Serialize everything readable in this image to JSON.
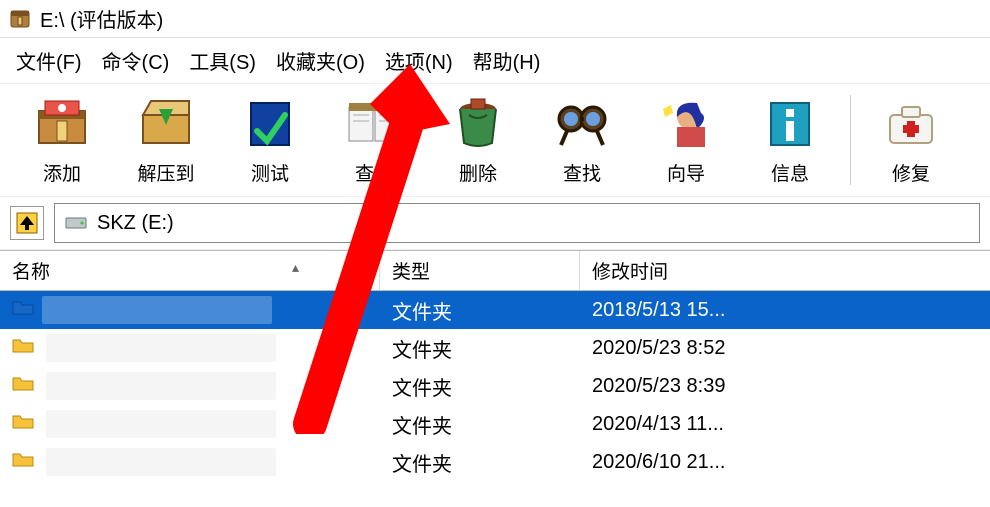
{
  "window": {
    "title": "E:\\ (评估版本)"
  },
  "menu": {
    "file": "文件(F)",
    "cmd": "命令(C)",
    "tools": "工具(S)",
    "fav": "收藏夹(O)",
    "opt": "选项(N)",
    "help": "帮助(H)"
  },
  "toolbar": {
    "add": "添加",
    "extract": "解压到",
    "test": "测试",
    "view": "查看",
    "delete": "删除",
    "find": "查找",
    "wizard": "向导",
    "info": "信息",
    "repair": "修复"
  },
  "path": {
    "label": "SKZ (E:)"
  },
  "columns": {
    "name": "名称",
    "type": "类型",
    "mtime": "修改时间"
  },
  "rows": [
    {
      "type": "文件夹",
      "mtime": "2018/5/13 15..."
    },
    {
      "type": "文件夹",
      "mtime": "2020/5/23 8:52"
    },
    {
      "type": "文件夹",
      "mtime": "2020/5/23 8:39"
    },
    {
      "type": "文件夹",
      "mtime": "2020/4/13 11..."
    },
    {
      "type": "文件夹",
      "mtime": "2020/6/10 21..."
    }
  ]
}
